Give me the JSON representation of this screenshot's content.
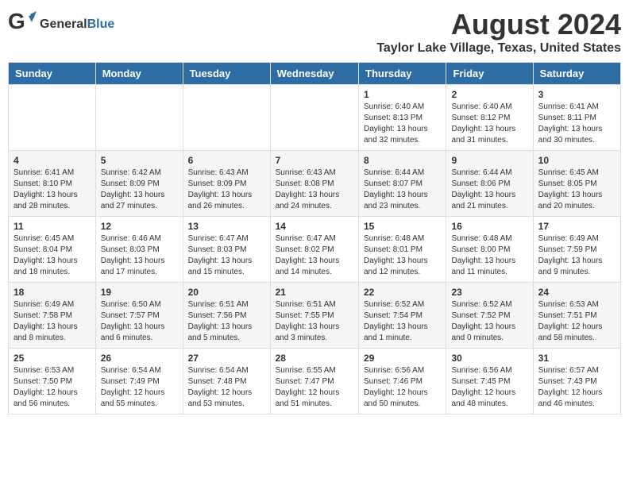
{
  "header": {
    "logo_general": "General",
    "logo_blue": "Blue",
    "month_year": "August 2024",
    "location": "Taylor Lake Village, Texas, United States"
  },
  "weekdays": [
    "Sunday",
    "Monday",
    "Tuesday",
    "Wednesday",
    "Thursday",
    "Friday",
    "Saturday"
  ],
  "weeks": [
    [
      {
        "day": "",
        "info": ""
      },
      {
        "day": "",
        "info": ""
      },
      {
        "day": "",
        "info": ""
      },
      {
        "day": "",
        "info": ""
      },
      {
        "day": "1",
        "info": "Sunrise: 6:40 AM\nSunset: 8:13 PM\nDaylight: 13 hours\nand 32 minutes."
      },
      {
        "day": "2",
        "info": "Sunrise: 6:40 AM\nSunset: 8:12 PM\nDaylight: 13 hours\nand 31 minutes."
      },
      {
        "day": "3",
        "info": "Sunrise: 6:41 AM\nSunset: 8:11 PM\nDaylight: 13 hours\nand 30 minutes."
      }
    ],
    [
      {
        "day": "4",
        "info": "Sunrise: 6:41 AM\nSunset: 8:10 PM\nDaylight: 13 hours\nand 28 minutes."
      },
      {
        "day": "5",
        "info": "Sunrise: 6:42 AM\nSunset: 8:09 PM\nDaylight: 13 hours\nand 27 minutes."
      },
      {
        "day": "6",
        "info": "Sunrise: 6:43 AM\nSunset: 8:09 PM\nDaylight: 13 hours\nand 26 minutes."
      },
      {
        "day": "7",
        "info": "Sunrise: 6:43 AM\nSunset: 8:08 PM\nDaylight: 13 hours\nand 24 minutes."
      },
      {
        "day": "8",
        "info": "Sunrise: 6:44 AM\nSunset: 8:07 PM\nDaylight: 13 hours\nand 23 minutes."
      },
      {
        "day": "9",
        "info": "Sunrise: 6:44 AM\nSunset: 8:06 PM\nDaylight: 13 hours\nand 21 minutes."
      },
      {
        "day": "10",
        "info": "Sunrise: 6:45 AM\nSunset: 8:05 PM\nDaylight: 13 hours\nand 20 minutes."
      }
    ],
    [
      {
        "day": "11",
        "info": "Sunrise: 6:45 AM\nSunset: 8:04 PM\nDaylight: 13 hours\nand 18 minutes."
      },
      {
        "day": "12",
        "info": "Sunrise: 6:46 AM\nSunset: 8:03 PM\nDaylight: 13 hours\nand 17 minutes."
      },
      {
        "day": "13",
        "info": "Sunrise: 6:47 AM\nSunset: 8:03 PM\nDaylight: 13 hours\nand 15 minutes."
      },
      {
        "day": "14",
        "info": "Sunrise: 6:47 AM\nSunset: 8:02 PM\nDaylight: 13 hours\nand 14 minutes."
      },
      {
        "day": "15",
        "info": "Sunrise: 6:48 AM\nSunset: 8:01 PM\nDaylight: 13 hours\nand 12 minutes."
      },
      {
        "day": "16",
        "info": "Sunrise: 6:48 AM\nSunset: 8:00 PM\nDaylight: 13 hours\nand 11 minutes."
      },
      {
        "day": "17",
        "info": "Sunrise: 6:49 AM\nSunset: 7:59 PM\nDaylight: 13 hours\nand 9 minutes."
      }
    ],
    [
      {
        "day": "18",
        "info": "Sunrise: 6:49 AM\nSunset: 7:58 PM\nDaylight: 13 hours\nand 8 minutes."
      },
      {
        "day": "19",
        "info": "Sunrise: 6:50 AM\nSunset: 7:57 PM\nDaylight: 13 hours\nand 6 minutes."
      },
      {
        "day": "20",
        "info": "Sunrise: 6:51 AM\nSunset: 7:56 PM\nDaylight: 13 hours\nand 5 minutes."
      },
      {
        "day": "21",
        "info": "Sunrise: 6:51 AM\nSunset: 7:55 PM\nDaylight: 13 hours\nand 3 minutes."
      },
      {
        "day": "22",
        "info": "Sunrise: 6:52 AM\nSunset: 7:54 PM\nDaylight: 13 hours\nand 1 minute."
      },
      {
        "day": "23",
        "info": "Sunrise: 6:52 AM\nSunset: 7:52 PM\nDaylight: 13 hours\nand 0 minutes."
      },
      {
        "day": "24",
        "info": "Sunrise: 6:53 AM\nSunset: 7:51 PM\nDaylight: 12 hours\nand 58 minutes."
      }
    ],
    [
      {
        "day": "25",
        "info": "Sunrise: 6:53 AM\nSunset: 7:50 PM\nDaylight: 12 hours\nand 56 minutes."
      },
      {
        "day": "26",
        "info": "Sunrise: 6:54 AM\nSunset: 7:49 PM\nDaylight: 12 hours\nand 55 minutes."
      },
      {
        "day": "27",
        "info": "Sunrise: 6:54 AM\nSunset: 7:48 PM\nDaylight: 12 hours\nand 53 minutes."
      },
      {
        "day": "28",
        "info": "Sunrise: 6:55 AM\nSunset: 7:47 PM\nDaylight: 12 hours\nand 51 minutes."
      },
      {
        "day": "29",
        "info": "Sunrise: 6:56 AM\nSunset: 7:46 PM\nDaylight: 12 hours\nand 50 minutes."
      },
      {
        "day": "30",
        "info": "Sunrise: 6:56 AM\nSunset: 7:45 PM\nDaylight: 12 hours\nand 48 minutes."
      },
      {
        "day": "31",
        "info": "Sunrise: 6:57 AM\nSunset: 7:43 PM\nDaylight: 12 hours\nand 46 minutes."
      }
    ]
  ]
}
